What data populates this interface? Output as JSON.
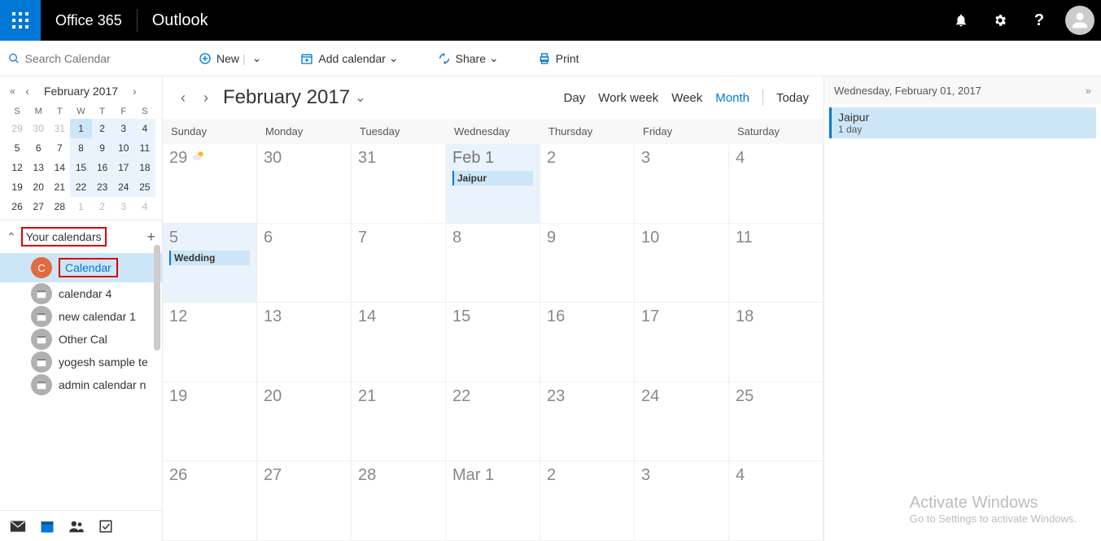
{
  "topbar": {
    "brand": "Office 365",
    "app": "Outlook"
  },
  "search": {
    "placeholder": "Search Calendar"
  },
  "commands": {
    "new": "New",
    "addCalendar": "Add calendar",
    "share": "Share",
    "print": "Print"
  },
  "mini": {
    "title": "February 2017",
    "dow": [
      "S",
      "M",
      "T",
      "W",
      "T",
      "F",
      "S"
    ],
    "days": [
      {
        "n": "29",
        "cls": "prev"
      },
      {
        "n": "30",
        "cls": "prev"
      },
      {
        "n": "31",
        "cls": "prev"
      },
      {
        "n": "1",
        "cls": "sel"
      },
      {
        "n": "2",
        "cls": "shade"
      },
      {
        "n": "3",
        "cls": "shade"
      },
      {
        "n": "4",
        "cls": "shade"
      },
      {
        "n": "5",
        "cls": ""
      },
      {
        "n": "6",
        "cls": ""
      },
      {
        "n": "7",
        "cls": ""
      },
      {
        "n": "8",
        "cls": "shade"
      },
      {
        "n": "9",
        "cls": "shade"
      },
      {
        "n": "10",
        "cls": "shade"
      },
      {
        "n": "11",
        "cls": "shade"
      },
      {
        "n": "12",
        "cls": ""
      },
      {
        "n": "13",
        "cls": ""
      },
      {
        "n": "14",
        "cls": ""
      },
      {
        "n": "15",
        "cls": "shade"
      },
      {
        "n": "16",
        "cls": "shade"
      },
      {
        "n": "17",
        "cls": "shade"
      },
      {
        "n": "18",
        "cls": "shade"
      },
      {
        "n": "19",
        "cls": ""
      },
      {
        "n": "20",
        "cls": ""
      },
      {
        "n": "21",
        "cls": ""
      },
      {
        "n": "22",
        "cls": "shade"
      },
      {
        "n": "23",
        "cls": "shade"
      },
      {
        "n": "24",
        "cls": "shade"
      },
      {
        "n": "25",
        "cls": "shade"
      },
      {
        "n": "26",
        "cls": ""
      },
      {
        "n": "27",
        "cls": ""
      },
      {
        "n": "28",
        "cls": ""
      },
      {
        "n": "1",
        "cls": "next"
      },
      {
        "n": "2",
        "cls": "next"
      },
      {
        "n": "3",
        "cls": "next"
      },
      {
        "n": "4",
        "cls": "next"
      }
    ]
  },
  "calGroup": {
    "title": "Your calendars",
    "items": [
      {
        "label": "Calendar",
        "color": "#e06b3f",
        "initial": "C",
        "active": true
      },
      {
        "label": "calendar 4"
      },
      {
        "label": "new calendar 1"
      },
      {
        "label": "Other Cal"
      },
      {
        "label": "yogesh sample te"
      },
      {
        "label": "admin calendar n"
      }
    ]
  },
  "calHeader": {
    "title": "February 2017",
    "views": [
      "Day",
      "Work week",
      "Week",
      "Month"
    ],
    "activeView": "Month",
    "today": "Today"
  },
  "dayHeaders": [
    "Sunday",
    "Monday",
    "Tuesday",
    "Wednesday",
    "Thursday",
    "Friday",
    "Saturday"
  ],
  "grid": [
    [
      {
        "n": "29",
        "weather": true
      },
      {
        "n": "30"
      },
      {
        "n": "31"
      },
      {
        "n": "Feb 1",
        "today": true,
        "sel": true,
        "evt": "Jaipur"
      },
      {
        "n": "2"
      },
      {
        "n": "3"
      },
      {
        "n": "4"
      }
    ],
    [
      {
        "n": "5",
        "sel": true,
        "evt": "Wedding"
      },
      {
        "n": "6"
      },
      {
        "n": "7"
      },
      {
        "n": "8"
      },
      {
        "n": "9"
      },
      {
        "n": "10"
      },
      {
        "n": "11"
      }
    ],
    [
      {
        "n": "12"
      },
      {
        "n": "13"
      },
      {
        "n": "14"
      },
      {
        "n": "15"
      },
      {
        "n": "16"
      },
      {
        "n": "17"
      },
      {
        "n": "18"
      }
    ],
    [
      {
        "n": "19"
      },
      {
        "n": "20"
      },
      {
        "n": "21"
      },
      {
        "n": "22",
        "link": true
      },
      {
        "n": "23"
      },
      {
        "n": "24"
      },
      {
        "n": "25"
      }
    ],
    [
      {
        "n": "26"
      },
      {
        "n": "27"
      },
      {
        "n": "28"
      },
      {
        "n": "Mar 1"
      },
      {
        "n": "2"
      },
      {
        "n": "3"
      },
      {
        "n": "4"
      }
    ]
  ],
  "agenda": {
    "dateLabel": "Wednesday, February 01, 2017",
    "items": [
      {
        "title": "Jaipur",
        "sub": "1 day"
      }
    ]
  },
  "watermark": {
    "l1": "Activate Windows",
    "l2": "Go to Settings to activate Windows."
  }
}
